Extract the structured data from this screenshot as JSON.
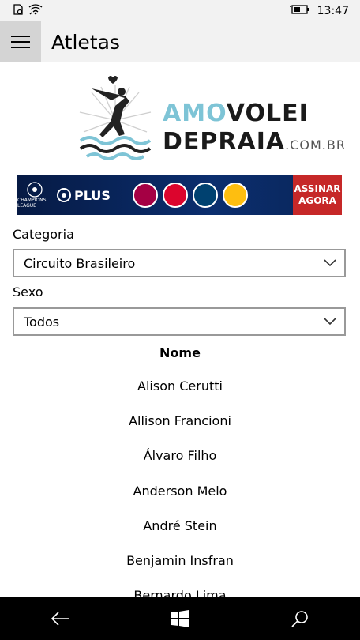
{
  "status": {
    "time": "13:47",
    "icons": [
      "sim-icon",
      "wifi-icon",
      "battery-icon"
    ]
  },
  "header": {
    "title": "Atletas",
    "menu_icon": "hamburger-icon"
  },
  "logo": {
    "word1": "AMO",
    "word2": "VOLEI",
    "word3": "DEPRAIA",
    "domain": ".COM.BR"
  },
  "banner": {
    "league": "CHAMPIONS LEAGUE",
    "plus": "PLUS",
    "cta_line1": "ASSINAR",
    "cta_line2": "AGORA",
    "crest_colors": [
      "#a50044",
      "#dc052d",
      "#004170",
      "#febe10"
    ]
  },
  "filters": {
    "categoria_label": "Categoria",
    "categoria_value": "Circuito Brasileiro",
    "sexo_label": "Sexo",
    "sexo_value": "Todos"
  },
  "list": {
    "header": "Nome",
    "items": [
      "Alison Cerutti",
      "Allison Francioni",
      "Álvaro Filho",
      "Anderson Melo",
      "André Stein",
      "Benjamin Insfran",
      "Bernardo Lima"
    ]
  },
  "navbar": {
    "icons": [
      "back-icon",
      "windows-icon",
      "search-icon"
    ]
  }
}
